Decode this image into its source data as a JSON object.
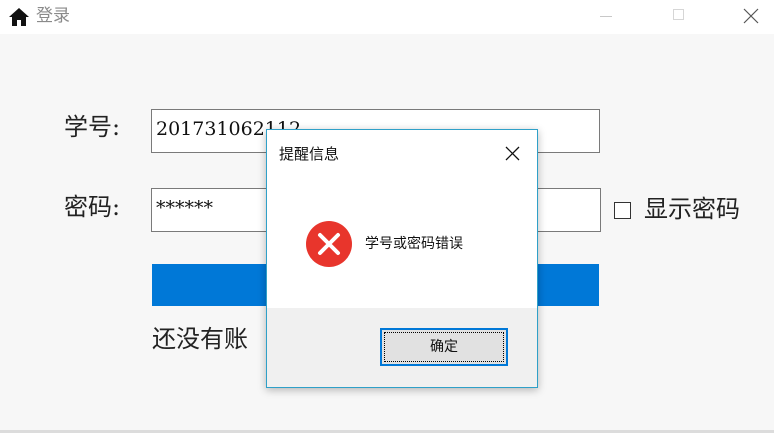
{
  "window": {
    "title": "登录",
    "icon": "home-icon"
  },
  "form": {
    "student_id_label": "学号:",
    "student_id_value": "201731062112",
    "password_label": "密码:",
    "password_value": "******",
    "show_password_label": "显示密码",
    "show_password_checked": false,
    "login_button_label": "",
    "register_text": "还没有账"
  },
  "dialog": {
    "title": "提醒信息",
    "message": "学号或密码错误",
    "icon": "error-icon",
    "ok_label": "确定"
  },
  "colors": {
    "accent": "#0078d7",
    "error": "#e8352c",
    "dialog_border": "#2fa0c8"
  }
}
